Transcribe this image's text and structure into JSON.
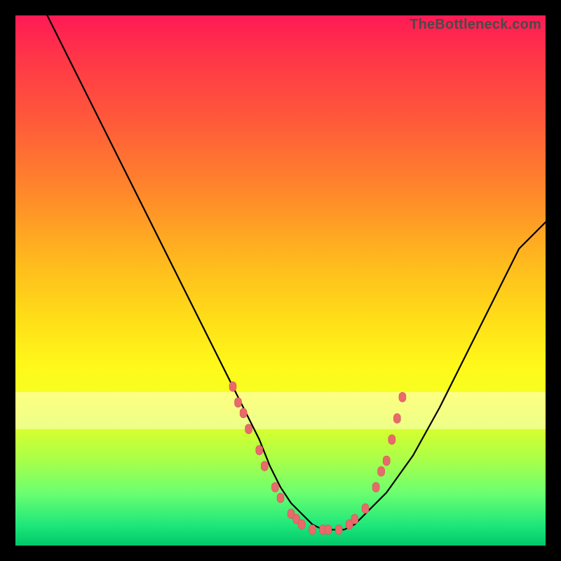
{
  "watermark": "TheBottleneck.com",
  "colors": {
    "frame_bg": "#000000",
    "curve_stroke": "#000000",
    "marker_fill": "#e86a6a",
    "marker_stroke": "#c94f4f"
  },
  "chart_data": {
    "type": "line",
    "title": "",
    "xlabel": "",
    "ylabel": "",
    "xlim": [
      0,
      100
    ],
    "ylim": [
      0,
      100
    ],
    "grid": false,
    "legend": false,
    "annotations": [],
    "series": [
      {
        "name": "curve",
        "x": [
          6,
          10,
          15,
          20,
          25,
          30,
          35,
          40,
          43,
          46,
          48,
          50,
          52,
          54,
          56,
          58,
          60,
          62,
          64,
          66,
          70,
          75,
          80,
          85,
          90,
          95,
          100
        ],
        "y": [
          100,
          92,
          82,
          72,
          62,
          52,
          42,
          32,
          26,
          20,
          15,
          11,
          8,
          6,
          4,
          3,
          3,
          3,
          4,
          6,
          10,
          17,
          26,
          36,
          46,
          56,
          61
        ]
      }
    ],
    "markers": [
      {
        "x": 41,
        "y": 30
      },
      {
        "x": 42,
        "y": 27
      },
      {
        "x": 43,
        "y": 25
      },
      {
        "x": 44,
        "y": 22
      },
      {
        "x": 46,
        "y": 18
      },
      {
        "x": 47,
        "y": 15
      },
      {
        "x": 49,
        "y": 11
      },
      {
        "x": 50,
        "y": 9
      },
      {
        "x": 52,
        "y": 6
      },
      {
        "x": 53,
        "y": 5
      },
      {
        "x": 54,
        "y": 4
      },
      {
        "x": 56,
        "y": 3
      },
      {
        "x": 58,
        "y": 3
      },
      {
        "x": 59,
        "y": 3
      },
      {
        "x": 61,
        "y": 3
      },
      {
        "x": 63,
        "y": 4
      },
      {
        "x": 64,
        "y": 5
      },
      {
        "x": 66,
        "y": 7
      },
      {
        "x": 68,
        "y": 11
      },
      {
        "x": 69,
        "y": 14
      },
      {
        "x": 70,
        "y": 16
      },
      {
        "x": 71,
        "y": 20
      },
      {
        "x": 72,
        "y": 24
      },
      {
        "x": 73,
        "y": 28
      }
    ],
    "band": {
      "top": 71,
      "bottom": 78
    }
  }
}
